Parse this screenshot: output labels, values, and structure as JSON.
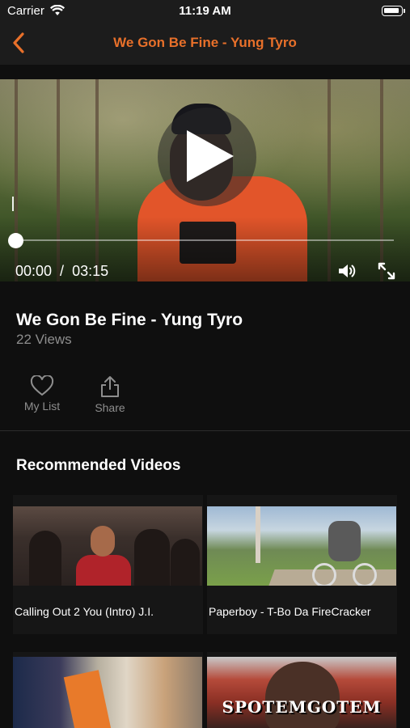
{
  "status_bar": {
    "carrier": "Carrier",
    "time": "11:19 AM"
  },
  "nav": {
    "title": "We Gon Be Fine - Yung Tyro",
    "accent_color": "#e8702a"
  },
  "player": {
    "current_time": "00:00",
    "separator": "/",
    "duration": "03:15",
    "progress": 0
  },
  "video": {
    "title": "We Gon Be Fine - Yung Tyro",
    "views": "22 Views"
  },
  "actions": {
    "my_list_label": "My List",
    "share_label": "Share"
  },
  "recommended": {
    "heading": "Recommended Videos",
    "items": [
      {
        "title": "Calling Out 2 You (Intro) J.I."
      },
      {
        "title": "Paperboy - T-Bo Da FireCracker"
      },
      {
        "title": ""
      },
      {
        "title": "",
        "thumbnail_text": "SPOTEMGOTEM"
      }
    ]
  }
}
